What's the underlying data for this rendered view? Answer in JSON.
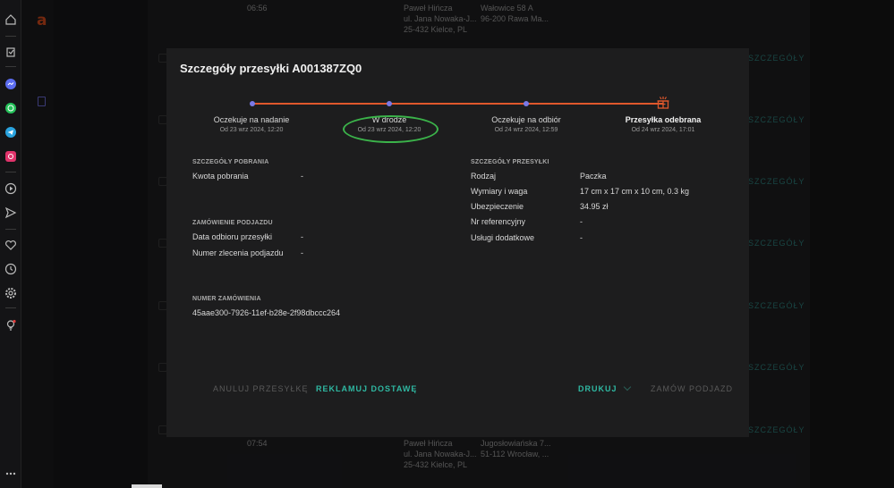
{
  "modal": {
    "title": "Szczegóły przesyłki A001387ZQ0",
    "steps": [
      {
        "label": "Oczekuje na nadanie",
        "date": "Od 23 wrz 2024, 12:20"
      },
      {
        "label": "W drodze",
        "date": "Od 23 wrz 2024, 12:20"
      },
      {
        "label": "Oczekuje na odbiór",
        "date": "Od 24 wrz 2024, 12:59"
      },
      {
        "label": "Przesyłka odebrana",
        "date": "Od 24 wrz 2024, 17:01"
      }
    ],
    "cod": {
      "title": "SZCZEGÓŁY POBRANIA",
      "amount_label": "Kwota pobrania",
      "amount_value": "-"
    },
    "pickup": {
      "title": "ZAMÓWIENIE PODJAZDU",
      "date_label": "Data odbioru przesyłki",
      "date_value": "-",
      "order_label": "Numer zlecenia podjazdu",
      "order_value": "-"
    },
    "order": {
      "title": "NUMER ZAMÓWIENIA",
      "value": "45aae300-7926-11ef-b28e-2f98dbccc264"
    },
    "shipment": {
      "title": "SZCZEGÓŁY PRZESYŁKI",
      "rows": [
        {
          "label": "Rodzaj",
          "value": "Paczka"
        },
        {
          "label": "Wymiary i waga",
          "value": "17 cm x 17 cm x 10 cm, 0.3 kg"
        },
        {
          "label": "Ubezpieczenie",
          "value": "34.95 zł"
        },
        {
          "label": "Nr referencyjny",
          "value": "-"
        },
        {
          "label": "Usługi dodatkowe",
          "value": "-"
        }
      ]
    },
    "buttons": {
      "cancel": "ANULUJ PRZESYŁKĘ",
      "complaint": "REKLAMUJ DOSTAWĘ",
      "print": "DRUKUJ",
      "order_pickup": "ZAMÓW PODJAZD"
    }
  },
  "background": {
    "top_row": {
      "time": "06:56",
      "sender_name": "Paweł Hińcza",
      "sender_street": "ul. Jana Nowaka-J...",
      "sender_city": "25-432 Kielce, PL",
      "recipient_street": "Wałowice 58 A",
      "recipient_city": "96-200 Rawa Ma..."
    },
    "bottom_row": {
      "time": "07:54",
      "sender_name": "Paweł Hińcza",
      "sender_street": "ul. Jana Nowaka-J...",
      "sender_city": "25-432 Kielce, PL",
      "recipient_street": "Jugosłowiańska 7...",
      "recipient_city": "51-112 Wrocław, ..."
    },
    "details_link": "SZCZEGÓŁY",
    "logo_letter": "a"
  },
  "colors": {
    "accent": "#2fb8a2",
    "track": "#e0582c",
    "dot": "#7a79e6",
    "highlight": "#3bb34a"
  }
}
